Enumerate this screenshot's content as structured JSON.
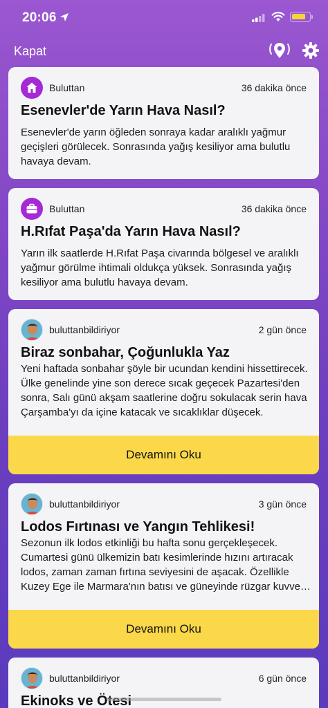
{
  "status_bar": {
    "time": "20:06"
  },
  "nav": {
    "close_label": "Kapat"
  },
  "colors": {
    "accent_purple": "#a52ad6",
    "button_yellow": "#fbd84a",
    "card_bg": "#f4f4f6"
  },
  "cards": [
    {
      "icon": "home-icon",
      "source": "Buluttan",
      "time": "36 dakika önce",
      "title": "Esenevler'de Yarın Hava Nasıl?",
      "body": "Esenevler'de yarın öğleden sonraya kadar aralıklı yağmur geçişleri görülecek. Sonrasında yağış kesiliyor ama bulutlu havaya devam."
    },
    {
      "icon": "briefcase-icon",
      "source": "Buluttan",
      "time": "36 dakika önce",
      "title": "H.Rıfat Paşa'da Yarın Hava Nasıl?",
      "body": "Yarın ilk saatlerde H.Rıfat Paşa civarında bölgesel ve aralıklı yağmur görülme ihtimali oldukça yüksek. Sonrasında yağış kesiliyor ama bulutlu havaya devam."
    },
    {
      "icon": "avatar",
      "source": "buluttanbildiriyor",
      "time": "2 gün önce",
      "title": "Biraz sonbahar, Çoğunlukla Yaz",
      "body": "Yeni haftada sonbahar şöyle bir ucundan kendini hissettirecek. Ülke genelinde yine son derece sıcak geçecek Pazartesi'den sonra, Salı günü akşam saatlerine doğru sokulacak serin hava Çarşamba'yı da içine katacak ve sıcaklıklar düşecek.",
      "button": "Devamını Oku"
    },
    {
      "icon": "avatar",
      "source": "buluttanbildiriyor",
      "time": "3 gün önce",
      "title": "Lodos Fırtınası ve Yangın Tehlikesi!",
      "body": "Sezonun ilk lodos etkinliği bu hafta sonu gerçekleşecek. Cumartesi günü ülkemizin batı kesimlerinde hızını artıracak lodos, zaman zaman fırtına seviyesini de aşacak. Özellikle Kuzey Ege ile Marmara'nın batısı ve güneyinde rüzgar kuvvetli esecek.",
      "button": "Devamını Oku"
    },
    {
      "icon": "avatar",
      "source": "buluttanbildiriyor",
      "time": "6 gün önce",
      "title": "Ekinoks ve Ötesi"
    }
  ]
}
